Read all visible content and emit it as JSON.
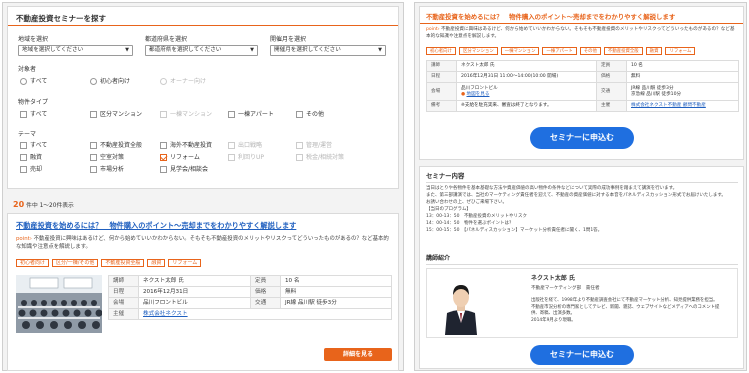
{
  "left": {
    "search_title": "不動産投資セミナーを探す",
    "region_label": "地域を選択",
    "region_value": "地域を選択してください",
    "pref_label": "都道府県を選択",
    "pref_value": "都道府県を選択してください",
    "month_label": "開催月を選択",
    "month_value": "開催月を選択してください",
    "audience_label": "対象者",
    "audience": [
      "すべて",
      "初心者向け",
      "オーナー向け"
    ],
    "property_label": "物件タイプ",
    "property": [
      "すべて",
      "区分マンション",
      "一棟マンション",
      "一棟アパート",
      "その他"
    ],
    "theme_label": "テーマ",
    "themes": [
      "すべて",
      "不動産投資全般",
      "海外不動産投資",
      "出口戦略",
      "管理/運営",
      "融資",
      "空室対策",
      "リフォーム",
      "利回りUP",
      "税金/相続対策",
      "売却",
      "市場分析",
      "見学会/相談会"
    ],
    "result_count": "20",
    "result_text": "件中 1～20件表示",
    "seminar_title": "不動産投資を始めるには？　物件購入のポイント～売却までをわかりやすく解説します",
    "point_label": "point",
    "point_text": "不動産投資に興味はあるけど、何から始めていいかわからない。そもそも不動産投資のメリットやリスクってどういったものがあるの？など基本的な知識や注意点を解説します。",
    "tags": [
      "初心者向け",
      "区分/一棟/その他",
      "不動産投資全般",
      "融資",
      "リフォーム"
    ],
    "table": {
      "speaker_h": "講師",
      "speaker": "ネクスト太郎 氏",
      "capacity_h": "定員",
      "capacity": "10 名",
      "date_h": "日程",
      "date": "2016年12月31日",
      "price_h": "価格",
      "price": "無料",
      "venue_h": "会場",
      "venue": "品川フロントビル",
      "access_h": "交通",
      "access": "JR線 品川駅 徒歩3分",
      "host_h": "主催",
      "host": "株式会社ネクスト"
    },
    "detail_button": "詳細を見る"
  },
  "right": {
    "title": "不動産投資を始めるには？　物件購入のポイント～売却までをわかりやすく解説します",
    "point_label": "point",
    "point_text": "不動産投資に興味はあるけど、何から始めていいかわからない。そもそも不動産投資のメリットやリスクってどういったものがあるの？など基本的な知識や注意点を解説します。",
    "tags": [
      "初心者向け",
      "区分マンション",
      "一棟マンション",
      "一棟アパート",
      "その他",
      "不動産投資全般",
      "融資",
      "リフォーム"
    ],
    "table": {
      "speaker_h": "講師",
      "speaker": "ネクスト太郎 氏",
      "capacity_h": "定員",
      "capacity": "10 名",
      "date_h": "日程",
      "date": "2016年12月31日 11:00～14:00(10:00 開場)",
      "price_h": "価格",
      "price": "無料",
      "venue_h": "会場",
      "venue": "品川フロントビル",
      "map_link": "地図を見る",
      "access_h": "交通",
      "access1": "JR線 品川駅 徒歩3分",
      "access2": "京急線 品川駅 徒歩10分",
      "note_h": "備考",
      "note": "※支給を駐充実来、審査は終了となります。",
      "host_h": "主催",
      "host": "株式会社ネクスト不動産 顧問不動産"
    },
    "apply_button": "セミナーに申込む",
    "content_title": "セミナー内容",
    "content_lines": [
      "当日はとりや各物件を基本基礎な方法や資産価値の高い物件の条件などについて実際の成功事例を踏まえて講演を行います。",
      "また、第三部講演では、当社のマーケティング責任者を迎えて、不動産の資産価値に対する本音をパネルディスカッション形式でお届けいたします。",
      "お誘い合わせの上、ぜひご来場下さい。",
      "【当日のプログラム】",
      "13：00-13：50　不動産投資のメリットやリスク",
      "14：00-14：50　物件を選ぶポイントは？",
      "15：00-15：50　【パネルディスカッション】マーケット分析責任者に聞く、1問1答。"
    ],
    "speaker_section": "講師紹介",
    "speaker_name": "ネクスト太郎 氏",
    "speaker_role": "不動産マーケティング部　責任者",
    "speaker_bio": [
      "出版社を経て、1998年より不動産調査会社にて不動産マーケット分析、知見提供業務を担当。",
      "不動産市況分析の専門家としてテレビ、新聞、雑誌、ウェブサイトなどメディアへのコメント提",
      "供、寄稿、出演多数。",
      "2014年9月より現職。"
    ],
    "apply_button2": "セミナーに申込む"
  },
  "colors": {
    "accent": "#e8641b",
    "link": "#1f5fbf",
    "button_blue": "#1f6fe0"
  }
}
